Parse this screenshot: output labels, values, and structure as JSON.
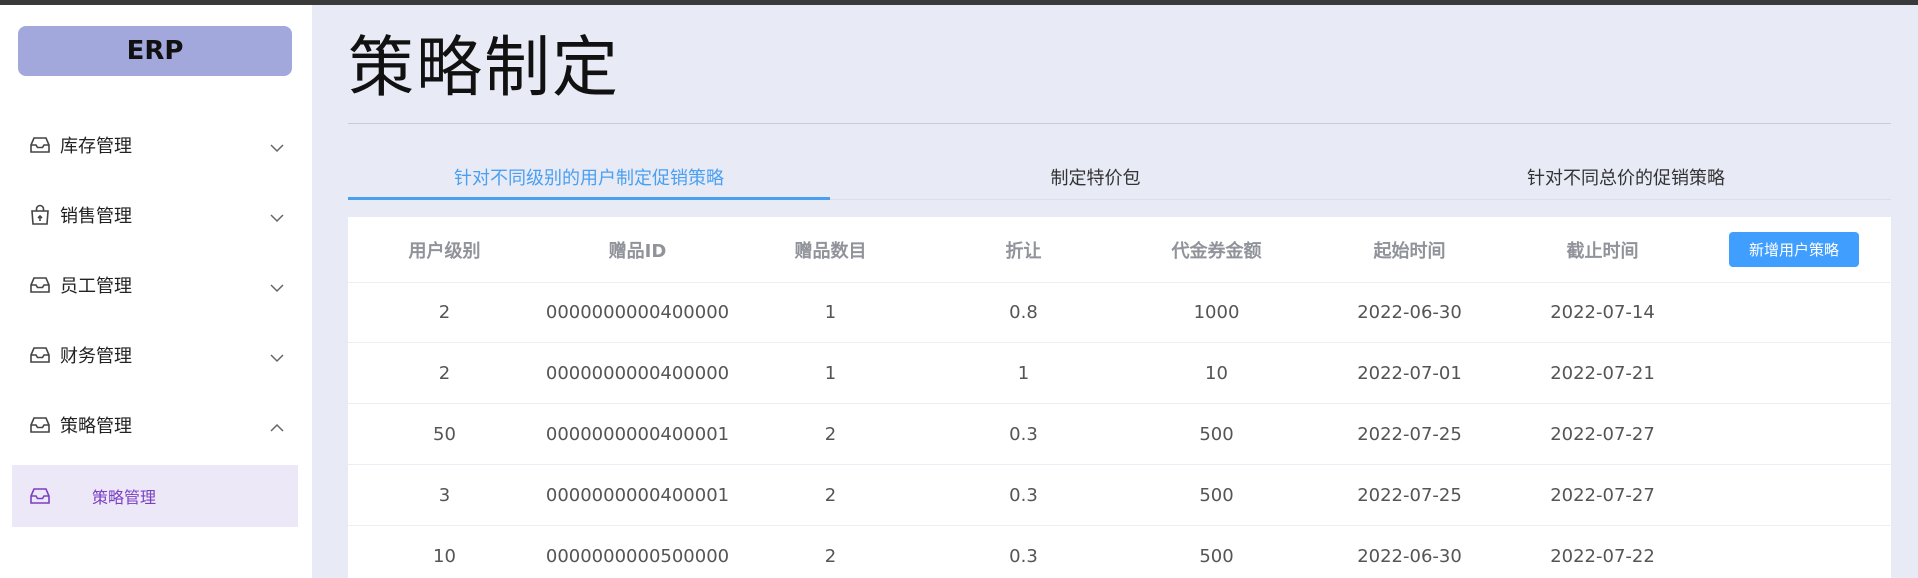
{
  "app": {
    "logo": "ERP"
  },
  "sidebar": {
    "items": [
      {
        "label": "库存管理",
        "icon": "inbox-icon",
        "chevron": "down"
      },
      {
        "label": "销售管理",
        "icon": "shopping-bag-icon",
        "chevron": "down"
      },
      {
        "label": "员工管理",
        "icon": "inbox-icon",
        "chevron": "down"
      },
      {
        "label": "财务管理",
        "icon": "inbox-icon",
        "chevron": "down"
      },
      {
        "label": "策略管理",
        "icon": "inbox-icon",
        "chevron": "up"
      }
    ],
    "submenu": {
      "label": "策略管理",
      "icon": "inbox-icon"
    },
    "active_color": "#7b3fc4",
    "active_bg": "#ece8f7"
  },
  "main": {
    "title": "策略制定",
    "tabs": [
      {
        "label": "针对不同级别的用户制定促销策略",
        "active": true
      },
      {
        "label": "制定特价包",
        "active": false
      },
      {
        "label": "针对不同总价的促销策略",
        "active": false
      }
    ],
    "accent_color": "#409eff"
  },
  "table": {
    "columns": [
      "用户级别",
      "赠品ID",
      "赠品数目",
      "折让",
      "代金券金额",
      "起始时间",
      "截止时间"
    ],
    "add_button": "新增用户策略",
    "rows": [
      [
        "2",
        "0000000000400000",
        "1",
        "0.8",
        "1000",
        "2022-06-30",
        "2022-07-14"
      ],
      [
        "2",
        "0000000000400000",
        "1",
        "1",
        "10",
        "2022-07-01",
        "2022-07-21"
      ],
      [
        "50",
        "0000000000400001",
        "2",
        "0.3",
        "500",
        "2022-07-25",
        "2022-07-27"
      ],
      [
        "3",
        "0000000000400001",
        "2",
        "0.3",
        "500",
        "2022-07-25",
        "2022-07-27"
      ],
      [
        "10",
        "0000000000500000",
        "2",
        "0.3",
        "500",
        "2022-06-30",
        "2022-07-22"
      ]
    ]
  }
}
